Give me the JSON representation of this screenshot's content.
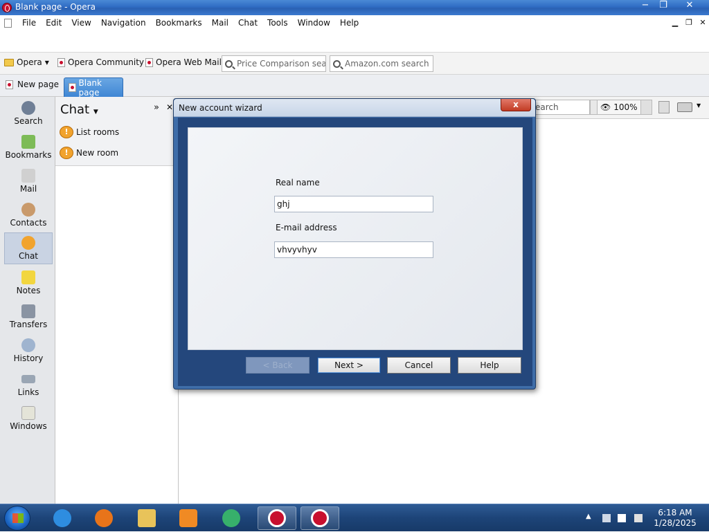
{
  "window": {
    "title": "Blank page - Opera",
    "caption_buttons": {
      "minimize": "−",
      "restore": "❐",
      "close": "✕"
    }
  },
  "menu": [
    "File",
    "Edit",
    "View",
    "Navigation",
    "Bookmarks",
    "Mail",
    "Chat",
    "Tools",
    "Window",
    "Help"
  ],
  "bookmarks_bar": {
    "opera": "Opera",
    "community": "Opera Community",
    "webmail": "Opera Web Mail",
    "search1_placeholder": "Price Comparison search",
    "search2_placeholder": "Amazon.com search"
  },
  "tabs": {
    "new_page": "New page",
    "active_tab": "Blank page"
  },
  "sidebar": {
    "items": [
      {
        "label": "Search",
        "icon": "search-icon",
        "color": "#6f7f96"
      },
      {
        "label": "Bookmarks",
        "icon": "bookmarks-icon",
        "color": "#7dbb57"
      },
      {
        "label": "Mail",
        "icon": "mail-icon",
        "color": "#d0d0d0"
      },
      {
        "label": "Contacts",
        "icon": "contacts-icon",
        "color": "#c99a6b"
      },
      {
        "label": "Chat",
        "icon": "chat-icon",
        "color": "#f1a32e"
      },
      {
        "label": "Notes",
        "icon": "notes-icon",
        "color": "#f2d640"
      },
      {
        "label": "Transfers",
        "icon": "transfers-icon",
        "color": "#8a94a3"
      },
      {
        "label": "History",
        "icon": "history-icon",
        "color": "#9fb4cf"
      },
      {
        "label": "Links",
        "icon": "links-icon",
        "color": "#9aa6b4"
      },
      {
        "label": "Windows",
        "icon": "windows-icon",
        "color": "#e4e4d8"
      }
    ],
    "active": "Chat"
  },
  "chat_panel": {
    "title": "Chat",
    "list_rooms": "List rooms",
    "new_room": "New room"
  },
  "content_toolbar": {
    "search_text": "earch",
    "zoom": "100%"
  },
  "dialog": {
    "title": "New account wizard",
    "close_label": "x",
    "real_name_label": "Real name",
    "real_name_value": "ghj",
    "email_label": "E-mail address",
    "email_value": "vhvyvhyv",
    "buttons": {
      "back": "< Back",
      "next": "Next >",
      "cancel": "Cancel",
      "help": "Help"
    }
  },
  "taskbar": {
    "time": "6:18 AM",
    "date": "1/28/2025",
    "apps": [
      {
        "name": "internet-explorer-icon",
        "color": "#2e8de0"
      },
      {
        "name": "firefox-icon",
        "color": "#e8741a"
      },
      {
        "name": "file-explorer-icon",
        "color": "#e8c35a"
      },
      {
        "name": "media-player-icon",
        "color": "#f08a24"
      },
      {
        "name": "messenger-icon",
        "color": "#37b06b"
      },
      {
        "name": "opera-icon",
        "color": "#c8102e"
      },
      {
        "name": "opera-icon",
        "color": "#c8102e"
      }
    ]
  }
}
